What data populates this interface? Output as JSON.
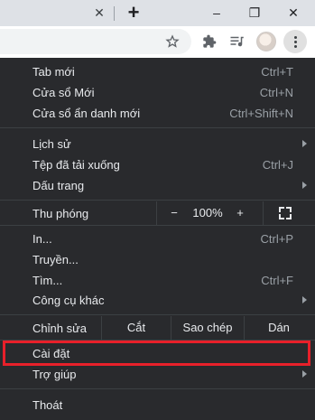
{
  "tabstrip": {
    "close_glyph": "✕",
    "new_tab_glyph": "+",
    "minimize_glyph": "–",
    "restore_glyph": "❐",
    "close_window_glyph": "✕"
  },
  "toolbar": {
    "bookmark_icon": "star-icon",
    "extensions_icon": "puzzle-icon",
    "media_icon": "media-queue-icon",
    "profile_icon": "avatar",
    "menu_icon": "three-dot-icon"
  },
  "menu": {
    "new_tab": {
      "label": "Tab mới",
      "shortcut": "Ctrl+T"
    },
    "new_window": {
      "label": "Cửa sổ Mới",
      "shortcut": "Ctrl+N"
    },
    "incognito": {
      "label": "Cửa sổ ẩn danh mới",
      "shortcut": "Ctrl+Shift+N"
    },
    "history": {
      "label": "Lịch sử"
    },
    "downloads": {
      "label": "Tệp đã tải xuống",
      "shortcut": "Ctrl+J"
    },
    "bookmarks": {
      "label": "Dấu trang"
    },
    "zoom": {
      "label": "Thu phóng",
      "minus": "−",
      "value": "100%",
      "plus": "+"
    },
    "print": {
      "label": "In...",
      "shortcut": "Ctrl+P"
    },
    "cast": {
      "label": "Truyền..."
    },
    "find": {
      "label": "Tìm...",
      "shortcut": "Ctrl+F"
    },
    "more_tools": {
      "label": "Công cụ khác"
    },
    "edit": {
      "label": "Chỉnh sửa",
      "cut": "Cắt",
      "copy": "Sao chép",
      "paste": "Dán"
    },
    "settings": {
      "label": "Cài đặt"
    },
    "help": {
      "label": "Trợ giúp"
    },
    "exit": {
      "label": "Thoát"
    }
  },
  "colors": {
    "menu_bg": "#292a2d",
    "highlight": "#e8202a",
    "tabstrip_bg": "#dee1e6"
  }
}
